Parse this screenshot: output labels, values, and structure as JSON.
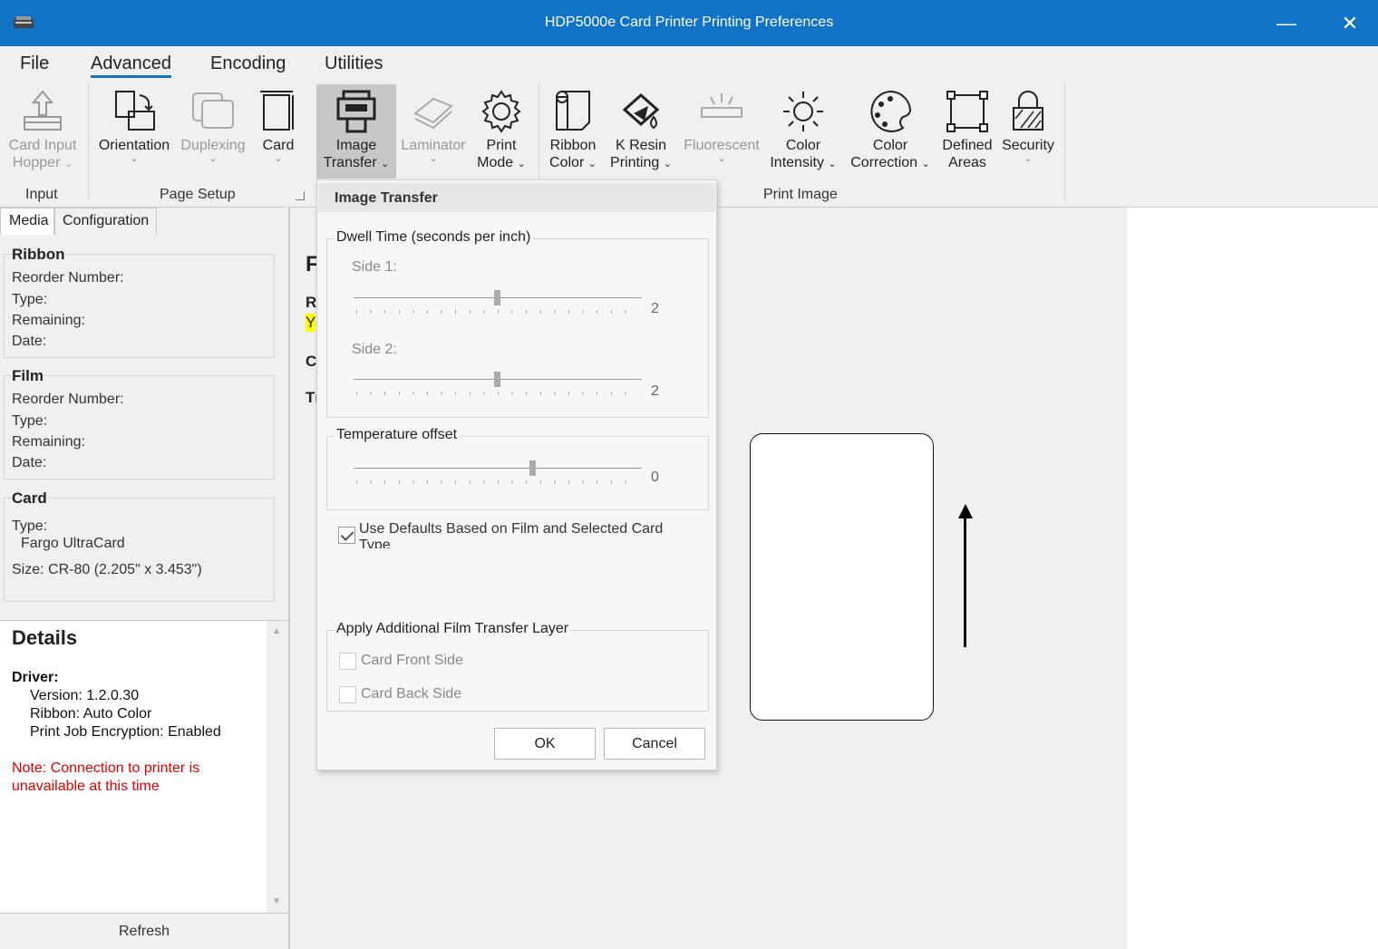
{
  "window": {
    "title": "HDP5000e Card Printer Printing Preferences",
    "minimize_glyph": "—",
    "close_glyph": "✕"
  },
  "menu": {
    "file": "File",
    "advanced": "Advanced",
    "encoding": "Encoding",
    "utilities": "Utilities"
  },
  "ribbon": {
    "card_input_hopper": [
      "Card Input",
      "Hopper"
    ],
    "orientation": "Orientation",
    "duplexing": "Duplexing",
    "card": "Card",
    "image_transfer": [
      "Image",
      "Transfer"
    ],
    "laminator": "Laminator",
    "print_mode": [
      "Print",
      "Mode"
    ],
    "ribbon_color": [
      "Ribbon",
      "Color"
    ],
    "k_resin_printing": [
      "K Resin",
      "Printing"
    ],
    "fluorescent": "Fluorescent",
    "color_intensity": [
      "Color",
      "Intensity"
    ],
    "color_correction": [
      "Color",
      "Correction"
    ],
    "defined_areas": [
      "Defined",
      "Areas"
    ],
    "security": "Security",
    "groups": {
      "input": "Input",
      "page_setup": "Page Setup",
      "print_image": "Print Image"
    }
  },
  "left_panel": {
    "tabs": [
      "Media",
      "Configuration"
    ],
    "ribbon": {
      "title": "Ribbon",
      "reorder": "Reorder Number:",
      "type": "Type:",
      "remaining": "Remaining:",
      "date": "Date:"
    },
    "film": {
      "title": "Film",
      "reorder": "Reorder Number:",
      "type": "Type:",
      "remaining": "Remaining:",
      "date": "Date:"
    },
    "card": {
      "title": "Card",
      "type": "Type:",
      "type_value": "Fargo UltraCard",
      "size": "Size: CR-80 (2.205\" x 3.453\")"
    },
    "details": {
      "title": "Details",
      "driver": "Driver:",
      "version": "Version: 1.2.0.30",
      "ribbon": "Ribbon: Auto Color",
      "encryption": "Print Job Encryption: Enabled",
      "note_line1": "Note: Connection to printer is",
      "note_line2": "unavailable at this time"
    },
    "refresh": "Refresh"
  },
  "center_behind": {
    "f": "F",
    "r": "R",
    "y": "Y",
    "c": "C",
    "t": "Tı"
  },
  "popup": {
    "title": "Image Transfer",
    "dwell_label": "Dwell Time (seconds per inch)",
    "side1_label": "Side 1:",
    "side1_value": "2",
    "side2_label": "Side 2:",
    "side2_value": "2",
    "temp_label": "Temperature offset",
    "temp_value": "0",
    "use_defaults_line1": "Use Defaults Based on Film and Selected Card",
    "use_defaults_line2": "Type",
    "apply_layer_label": "Apply Additional Film Transfer Layer",
    "card_front": "Card Front Side",
    "card_back": "Card Back Side",
    "ok": "OK",
    "cancel": "Cancel"
  },
  "colors": {
    "titlebar": "#1173c5",
    "note_red": "#e00000",
    "highlight": "#ffff00"
  }
}
